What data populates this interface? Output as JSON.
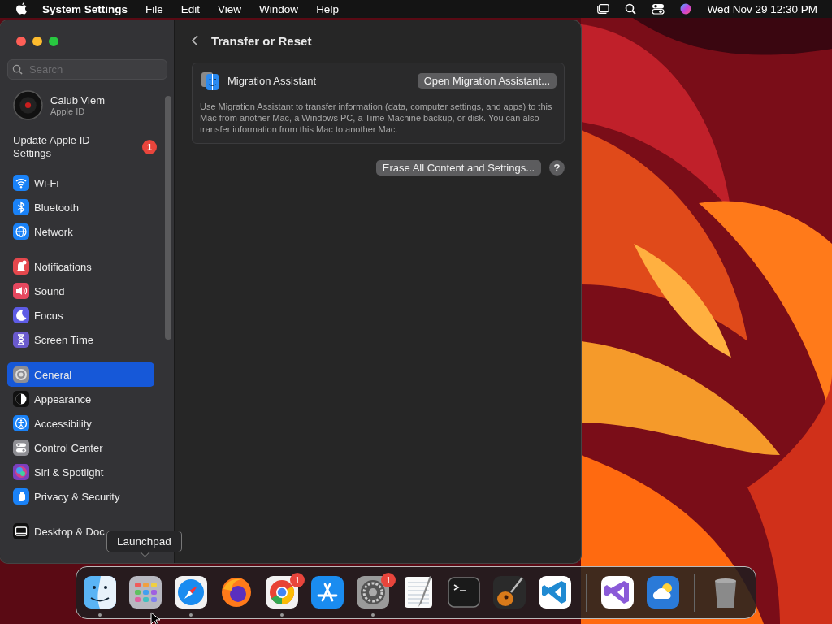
{
  "menu_bar": {
    "app_name": "System Settings",
    "menus": [
      "File",
      "Edit",
      "View",
      "Window",
      "Help"
    ],
    "clock": "Wed Nov 29  12:30 PM"
  },
  "window": {
    "search": {
      "placeholder": "Search"
    },
    "account": {
      "name": "Calub Viem",
      "subtitle": "Apple ID"
    },
    "update": {
      "label": "Update Apple ID Settings",
      "badge": "1"
    },
    "groups": [
      [
        {
          "label": "Wi-Fi",
          "kind": "wifi",
          "color": "#1a82f7",
          "selected": false
        },
        {
          "label": "Bluetooth",
          "kind": "bluetooth",
          "color": "#1a82f7",
          "selected": false
        },
        {
          "label": "Network",
          "kind": "network",
          "color": "#1a82f7",
          "selected": false
        }
      ],
      [
        {
          "label": "Notifications",
          "kind": "bell",
          "color": "#e5484d",
          "selected": false
        },
        {
          "label": "Sound",
          "kind": "sound",
          "color": "#e5485f",
          "selected": false
        },
        {
          "label": "Focus",
          "kind": "moon",
          "color": "#5e5ce6",
          "selected": false
        },
        {
          "label": "Screen Time",
          "kind": "hourglass",
          "color": "#6a5acd",
          "selected": false
        }
      ],
      [
        {
          "label": "General",
          "kind": "gear",
          "color": "#8e8e93",
          "selected": true
        },
        {
          "label": "Appearance",
          "kind": "appearance",
          "color": "#111111",
          "selected": false
        },
        {
          "label": "Accessibility",
          "kind": "accessibility",
          "color": "#1a82f7",
          "selected": false
        },
        {
          "label": "Control Center",
          "kind": "toggles",
          "color": "#8e8e93",
          "selected": false
        },
        {
          "label": "Siri & Spotlight",
          "kind": "siri",
          "color": "#7a3fbf",
          "selected": false
        },
        {
          "label": "Privacy & Security",
          "kind": "hand",
          "color": "#1a82f7",
          "selected": false
        }
      ],
      [
        {
          "label": "Desktop & Doc",
          "kind": "dock",
          "color": "#111111",
          "selected": false
        }
      ]
    ],
    "page": {
      "title": "Transfer or Reset",
      "card": {
        "label": "Migration Assistant",
        "button": "Open Migration Assistant...",
        "description": "Use Migration Assistant to transfer information (data, computer settings, and apps) to this Mac from another Mac, a Windows PC, a Time Machine backup, or disk. You can also transfer information from this Mac to another Mac."
      },
      "erase_button": "Erase All Content and Settings...",
      "help_button": "?"
    }
  },
  "tooltip": "Launchpad",
  "dock": [
    {
      "kind": "finder",
      "running": true
    },
    {
      "kind": "launchpad",
      "running": false
    },
    {
      "kind": "safari",
      "running": true
    },
    {
      "kind": "firefox",
      "running": false
    },
    {
      "kind": "chrome",
      "running": true,
      "badge": "1"
    },
    {
      "kind": "appstore",
      "running": false
    },
    {
      "kind": "settings",
      "running": true,
      "badge": "1"
    },
    {
      "kind": "textedit",
      "running": false
    },
    {
      "kind": "terminal",
      "running": false
    },
    {
      "kind": "guitar",
      "running": false
    },
    {
      "kind": "vscode",
      "running": false
    },
    {
      "kind": "divider"
    },
    {
      "kind": "visualstudio",
      "running": false
    },
    {
      "kind": "weather",
      "running": false
    },
    {
      "kind": "divider"
    },
    {
      "kind": "trash",
      "running": false
    }
  ]
}
